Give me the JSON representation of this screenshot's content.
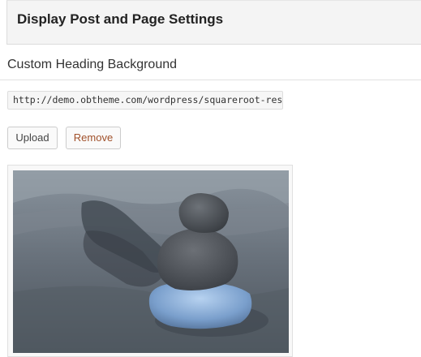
{
  "header": {
    "title": "Display Post and Page Settings"
  },
  "section": {
    "heading": "Custom Heading Background"
  },
  "url_field": {
    "value": "http://demo.obtheme.com/wordpress/squareroot-resum"
  },
  "buttons": {
    "upload_label": "Upload",
    "remove_label": "Remove"
  },
  "preview": {
    "alt": "stacked-stones-photo"
  },
  "colors": {
    "panel_background": "#f4f4f4",
    "remove_text": "#a0502a",
    "border": "#dcdcdc"
  }
}
